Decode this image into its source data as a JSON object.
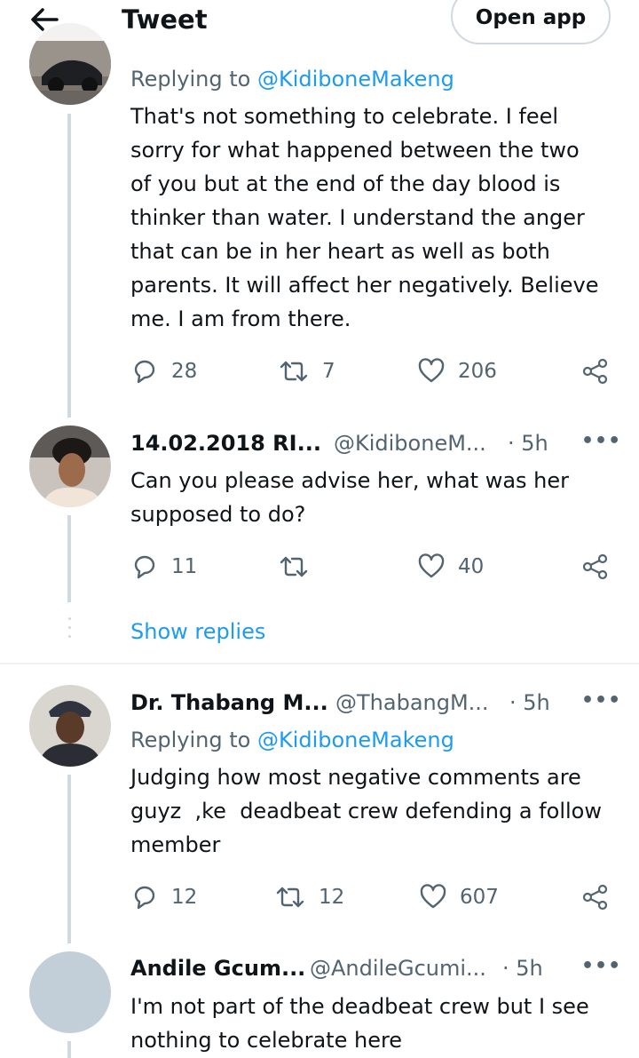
{
  "header": {
    "title": "Tweet",
    "open_app_label": "Open app"
  },
  "tweets": [
    {
      "reply_prefix": "Replying to",
      "reply_to": "@KidiboneMakeng",
      "text": "That's not something to celebrate. I feel\nsorry for what happened between the two\nof you but at the end of the day blood is\nthinker than water. I understand the anger\nthat can be in her heart as well as both\nparents. It will affect her negatively. Believe\nme. I am from there.",
      "replies": "28",
      "retweets": "7",
      "likes": "206"
    },
    {
      "name": "14.02.2018 RI...",
      "handle": "@KidiboneM...",
      "time": "· 5h",
      "text": "Can you please advise her, what was her\nsupposed to do?",
      "replies": "11",
      "retweets": "",
      "likes": "40"
    },
    {
      "name": "Dr. Thabang M...",
      "handle": "@ThabangM...",
      "time": "· 5h",
      "reply_prefix": "Replying to",
      "reply_to": "@KidiboneMakeng",
      "text": "Judging how most negative comments are\nguyz  ,ke  deadbeat crew defending a follow\nmember",
      "replies": "12",
      "retweets": "12",
      "likes": "607"
    },
    {
      "name": "Andile Gcum...",
      "handle": "@AndileGcumi...",
      "time": "· 5h",
      "text": "I'm not part of the deadbeat crew but I see\nnothing to celebrate here"
    }
  ],
  "show_replies_label": "Show replies",
  "more_label": "•••",
  "colors": {
    "accent": "#1d9bf0",
    "muted": "#536471",
    "line": "#cfd9de",
    "text": "#0f1419"
  },
  "icons": [
    "back-arrow-icon",
    "reply-icon",
    "retweet-icon",
    "like-icon",
    "share-icon",
    "more-icon"
  ]
}
